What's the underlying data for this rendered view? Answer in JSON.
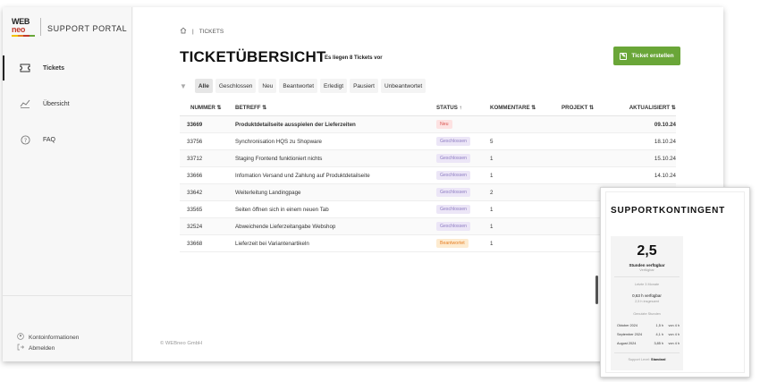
{
  "brand": {
    "logo_line1": "WEB",
    "logo_line2": "neo",
    "portal_title": "SUPPORT PORTAL",
    "logo_colors": [
      "#f2c200",
      "#e67e22",
      "#c0392b",
      "#6aa638"
    ]
  },
  "sidebar": {
    "items": [
      {
        "label": "Tickets",
        "icon": "ticket-icon",
        "active": true
      },
      {
        "label": "Übersicht",
        "icon": "chart-line-icon",
        "active": false
      },
      {
        "label": "FAQ",
        "icon": "question-icon",
        "active": false
      }
    ],
    "bottom_links": [
      {
        "label": "Kontoinformationen",
        "icon": "user-icon"
      },
      {
        "label": "Abmelden",
        "icon": "logout-icon"
      }
    ]
  },
  "breadcrumb": {
    "home_icon": "home-icon",
    "separator": "|",
    "current": "TICKETS"
  },
  "header": {
    "title": "TICKETÜBERSICHT",
    "subtitle": "Es liegen 8 Tickets vor",
    "create_button": "Ticket erstellen"
  },
  "filters": [
    "Alle",
    "Geschlossen",
    "Neu",
    "Beantwortet",
    "Erledigt",
    "Pausiert",
    "Unbeantwortet"
  ],
  "active_filter": "Alle",
  "table": {
    "columns": [
      "NUMMER ⇅",
      "BETREFF ⇅",
      "STATUS ↑",
      "KOMMENTARE ⇅",
      "PROJEKT ⇅",
      "AKTUALISIERT ⇅"
    ],
    "rows": [
      {
        "nummer": "33669",
        "betreff": "Produktdetailseite ausspielen der Lieferzeiten",
        "status": "Neu",
        "kommentare": "",
        "projekt": "",
        "aktualisiert": "09.10.24",
        "bold": true
      },
      {
        "nummer": "33756",
        "betreff": "Synchronisation HQS zu Shopware",
        "status": "Geschlossen",
        "kommentare": "5",
        "projekt": "",
        "aktualisiert": "18.10.24",
        "bold": false
      },
      {
        "nummer": "33712",
        "betreff": "Staging Frontend funktioniert nichts",
        "status": "Geschlossen",
        "kommentare": "1",
        "projekt": "",
        "aktualisiert": "15.10.24",
        "bold": false
      },
      {
        "nummer": "33666",
        "betreff": "Infomation Versand und Zahlung auf Produktdetailseite",
        "status": "Geschlossen",
        "kommentare": "1",
        "projekt": "",
        "aktualisiert": "14.10.24",
        "bold": false
      },
      {
        "nummer": "33642",
        "betreff": "Weiterleitung Landingpage",
        "status": "Geschlossen",
        "kommentare": "2",
        "projekt": "",
        "aktualisiert": "",
        "bold": false
      },
      {
        "nummer": "33565",
        "betreff": "Seiten öffnen sich in einem neuen Tab",
        "status": "Geschlossen",
        "kommentare": "1",
        "projekt": "",
        "aktualisiert": "",
        "bold": false
      },
      {
        "nummer": "32524",
        "betreff": "Abweichende Lieferzeitangabe Webshop",
        "status": "Geschlossen",
        "kommentare": "1",
        "projekt": "",
        "aktualisiert": "",
        "bold": false
      },
      {
        "nummer": "33668",
        "betreff": "Lieferzeit bei Variantenartikeln",
        "status": "Beantwortet",
        "kommentare": "1",
        "projekt": "",
        "aktualisiert": "",
        "bold": false
      }
    ]
  },
  "status_colors": {
    "Neu": {
      "bg": "#fde2e2",
      "fg": "#d9534f"
    },
    "Geschlossen": {
      "bg": "#ece6f7",
      "fg": "#8e7cc3"
    },
    "Beantwortet": {
      "bg": "#fdebd0",
      "fg": "#e67e22"
    }
  },
  "footer": {
    "copyright": "© WEBneo GmbH"
  },
  "support_panel": {
    "title": "SUPPORTKONTINGENT",
    "hours_value": "2,5",
    "hours_label": "Stunden verfügbar",
    "hours_sublabel": "Verfügbar",
    "section1_label": "Letzte 3 Monate",
    "available_label": "0,63 h verfügbar",
    "available_sub": "2,5 h insgesamt",
    "section2_label": "Genutzte Stunden",
    "months": [
      {
        "month": "Oktober 2024",
        "used": "1,5 h",
        "of": "von 4 h"
      },
      {
        "month": "September 2024",
        "used": "4,1 h",
        "of": "von 4 h"
      },
      {
        "month": "August 2024",
        "used": "3,85 h",
        "of": "von 4 h"
      }
    ],
    "level_prefix": "Support Level:",
    "level_value": "Standard"
  }
}
